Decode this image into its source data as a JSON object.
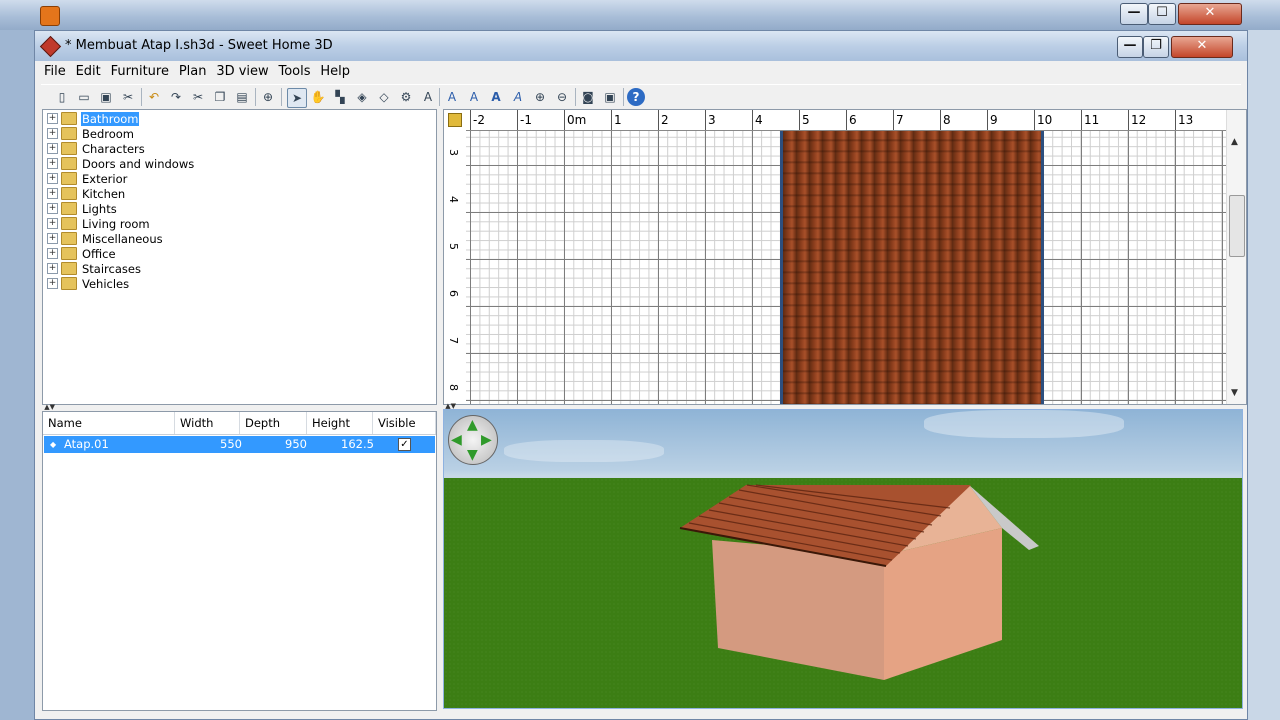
{
  "outer_window": {
    "buttons": {
      "minimize": "—",
      "maximize": "☐",
      "close": "✕"
    }
  },
  "app": {
    "title": "* Membuat Atap I.sh3d - Sweet Home 3D",
    "window_buttons": {
      "minimize": "—",
      "maximize": "❐",
      "close": "✕"
    }
  },
  "menu": [
    "File",
    "Edit",
    "Furniture",
    "Plan",
    "3D view",
    "Tools",
    "Help"
  ],
  "toolbar_icons": [
    "new-file-icon",
    "open-folder-icon",
    "save-icon",
    "cut-preferences-icon",
    "undo-icon",
    "redo-icon",
    "cut-icon",
    "copy-icon",
    "paste-icon",
    "add-furniture-icon",
    "select-pointer-icon",
    "pan-hand-icon",
    "create-walls-icon",
    "create-rooms-icon",
    "create-polylines-icon",
    "create-dimensions-icon",
    "add-text-icon",
    "increase-text-icon",
    "decrease-text-icon",
    "bold-text-icon",
    "italic-text-icon",
    "zoom-in-icon",
    "zoom-out-icon",
    "create-photo-icon",
    "create-video-icon",
    "help-icon"
  ],
  "catalog": {
    "categories": [
      "Bathroom",
      "Bedroom",
      "Characters",
      "Doors and windows",
      "Exterior",
      "Kitchen",
      "Lights",
      "Living room",
      "Miscellaneous",
      "Office",
      "Staircases",
      "Vehicles"
    ],
    "selected": "Bathroom"
  },
  "furniture_table": {
    "columns": [
      "Name",
      "Width",
      "Depth",
      "Height",
      "Visible"
    ],
    "rows": [
      {
        "name": "Atap.01",
        "width": "550",
        "depth": "950",
        "height": "162.5",
        "visible": true
      }
    ]
  },
  "plan": {
    "ruler_x": [
      "-2",
      "-1",
      "0m",
      "1",
      "2",
      "3",
      "4",
      "5",
      "6",
      "7",
      "8",
      "9",
      "10",
      "11",
      "12",
      "13"
    ],
    "ruler_y": [
      "3",
      "4",
      "5",
      "6",
      "7",
      "8"
    ]
  },
  "colors": {
    "selection": "#3399ff",
    "roof": "#8a3d1c",
    "wall": "#e3a07c",
    "grass": "#3c7e14"
  }
}
